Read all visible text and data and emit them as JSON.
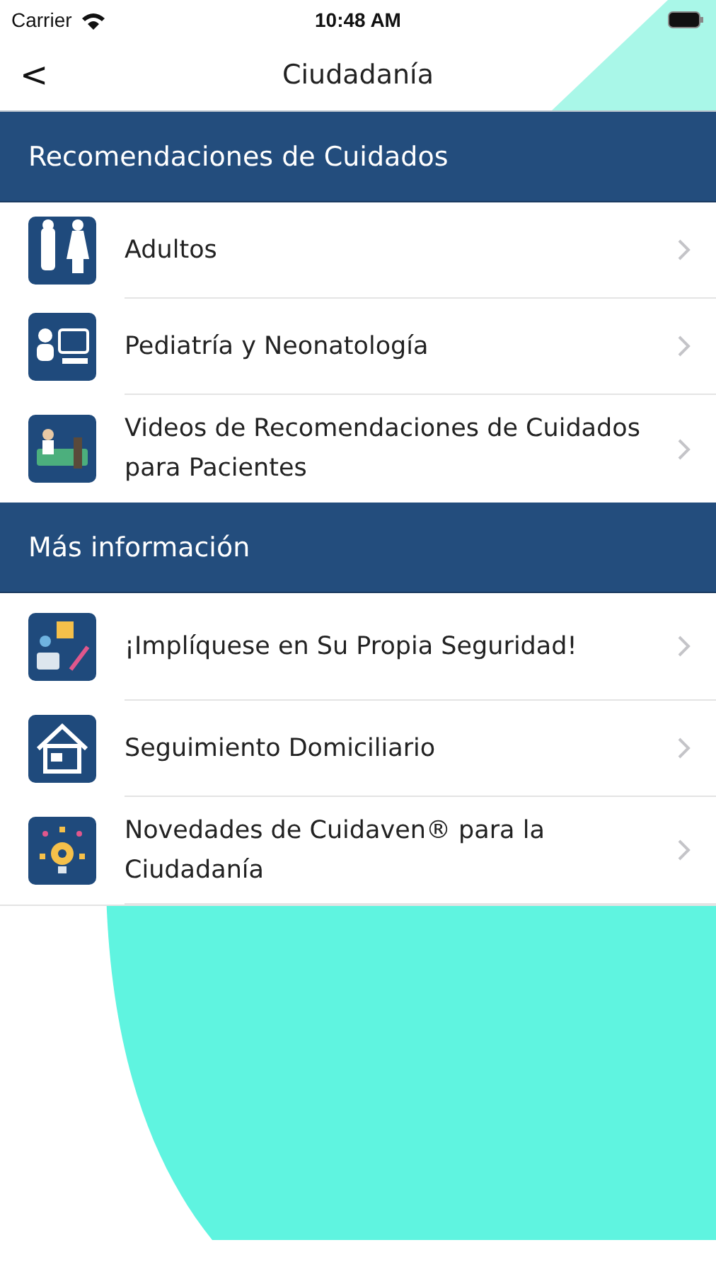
{
  "status_bar": {
    "carrier": "Carrier",
    "time": "10:48 AM"
  },
  "nav": {
    "back": "<",
    "title": "Ciudadanía"
  },
  "sections": [
    {
      "title": "Recomendaciones de Cuidados",
      "items": [
        {
          "label": "Adultos",
          "kind": "adults"
        },
        {
          "label": "Pediatría y Neonatología",
          "kind": "pediatrics"
        },
        {
          "label": "Videos de Recomendaciones de Cuidados para Pacientes",
          "kind": "video"
        }
      ]
    },
    {
      "title": "Más información",
      "items": [
        {
          "label": "¡Implíquese en Su Propia Seguridad!",
          "kind": "safety"
        },
        {
          "label": "Seguimiento Domiciliario",
          "kind": "home"
        },
        {
          "label": "Novedades de Cuidaven® para la Ciudadanía",
          "kind": "news"
        }
      ]
    }
  ]
}
